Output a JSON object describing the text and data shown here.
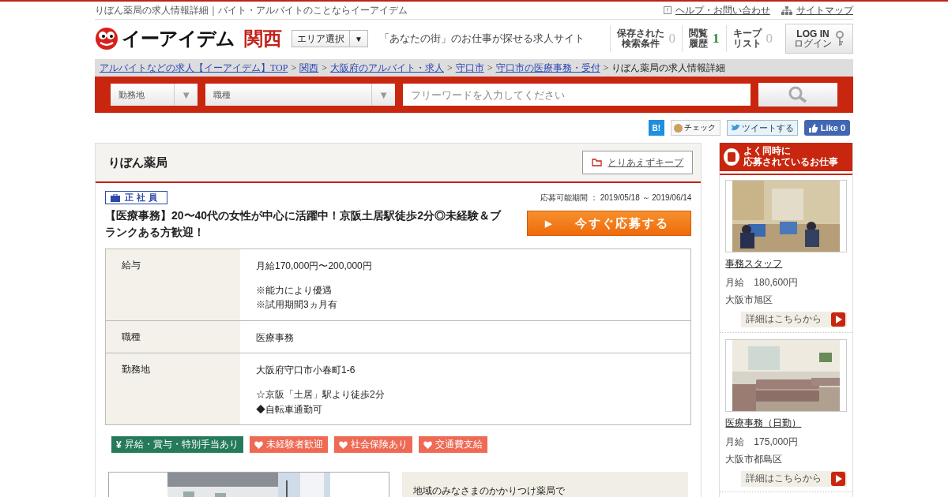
{
  "top_bar": {
    "page_title": "りぼん薬局の求人情報詳細｜バイト・アルバイトのことならイーアイデム",
    "links": [
      {
        "label": "ヘルプ・お問い合わせ",
        "kind": "help"
      },
      {
        "label": "サイトマップ",
        "kind": "sitemap"
      }
    ]
  },
  "header": {
    "logo_text": "イーアイデム",
    "region": "関西",
    "area_select": "エリア選択",
    "area_caret": "▼",
    "tagline": "「あなたの街」のお仕事が探せる求人サイト",
    "counters": [
      {
        "label_lines": [
          "保存された",
          "検索条件"
        ],
        "count": "0",
        "highlighted": false
      },
      {
        "label_lines": [
          "閲覧",
          "履歴"
        ],
        "count": "1",
        "highlighted": true
      },
      {
        "label_lines": [
          "キープ",
          "リスト"
        ],
        "count": "0",
        "highlighted": false
      }
    ],
    "login": {
      "label": "LOG IN",
      "sublabel": "ログイン"
    }
  },
  "breadcrumb": {
    "links": [
      "アルバイトなどの求人【イーアイデム】TOP",
      "関西",
      "大阪府のアルバイト・求人",
      "守口市",
      "守口市の医療事務・受付"
    ],
    "separator": ">",
    "current": "りぼん薬局の求人情報詳細"
  },
  "search": {
    "selects": [
      {
        "label": "勤務地"
      },
      {
        "label": "職種"
      }
    ],
    "caret": "▼",
    "placeholder": "フリーワードを入力してください"
  },
  "social": {
    "hatena": "B!",
    "mixi": "チェック",
    "tweet": "ツイートする",
    "like": "Like 0"
  },
  "job": {
    "company": "りぼん薬局",
    "keep_button": "とりあえずキープ",
    "employment_type": "正社員",
    "period": "応募可能期間 ： 2019/05/18 ～ 2019/06/14",
    "title": "【医療事務】20〜40代の女性が中心に活躍中！京阪土居駅徒歩2分◎未経験＆ブランクある方歓迎！",
    "apply_button": "今すぐ応募する",
    "apply_arrow": "▶",
    "details": [
      {
        "label": "給与",
        "paragraphs": [
          [
            "月給170,000円〜200,000円"
          ],
          [
            "※能力により優遇",
            "※試用期間3ヵ月有"
          ]
        ]
      },
      {
        "label": "職種",
        "paragraphs": [
          [
            "医療事務"
          ]
        ]
      },
      {
        "label": "勤務地",
        "paragraphs": [
          [
            "大阪府守口市小春町1-6"
          ],
          [
            "☆京阪「土居」駅より徒歩2分",
            "◆自転車通勤可"
          ]
        ]
      }
    ],
    "tags": [
      {
        "label": "昇給・賞与・特別手当あり",
        "kind": "yen",
        "icon": "¥",
        "color": "#257a5a"
      },
      {
        "label": "未経験者歓迎",
        "kind": "heart",
        "color": "#ee6a55"
      },
      {
        "label": "社会保険あり",
        "kind": "heart",
        "color": "#ee6a55"
      },
      {
        "label": "交通費支給",
        "kind": "heart",
        "color": "#ee6a55"
      }
    ],
    "intro": "地域のみなさまのかかりつけ薬局で"
  },
  "sidebar": {
    "title_lines": [
      "よく同時に",
      "応募されているお仕事"
    ],
    "jobs": [
      {
        "title": "事務スタッフ",
        "salary_label": "月給",
        "salary": "180,600円",
        "location": "大阪市旭区",
        "link": "詳細はこちらから"
      },
      {
        "title": "医療事務（日勤）",
        "salary_label": "月給",
        "salary": "175,000円",
        "location": "大阪市都島区",
        "link": "詳細はこちらから"
      }
    ]
  }
}
